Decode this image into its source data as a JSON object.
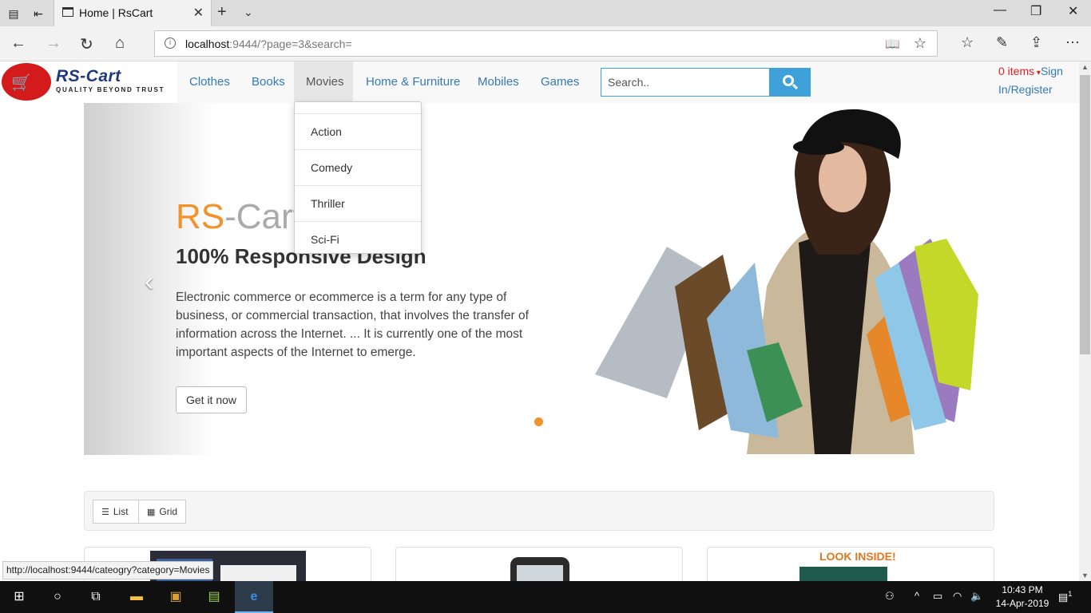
{
  "browser": {
    "tab_title": "Home | RsCart",
    "url_host": "localhost",
    "url_rest": ":9444/?page=3&search="
  },
  "site": {
    "brand": "RS-Cart",
    "tagline": "QUALITY BEYOND TRUST",
    "nav": [
      "Clothes",
      "Books",
      "Movies",
      "Home & Furniture",
      "Mobiles",
      "Games"
    ],
    "search_placeholder": "Search..",
    "cart_items": "0 items",
    "signin": "Sign In/Register"
  },
  "dropdown": {
    "items": [
      "Action",
      "Comedy",
      "Thriller",
      "Sci-Fi"
    ]
  },
  "carousel": {
    "title_part1": "RS",
    "title_part2": "-Cart",
    "subtitle": "100% Responsive Design",
    "text": "Electronic commerce or ecommerce is a term for any type of business, or commercial transaction, that involves the transfer of information across the Internet. ... It is currently one of the most important aspects of the Internet to emerge.",
    "button": "Get it now"
  },
  "view": {
    "list": "List",
    "grid": "Grid"
  },
  "status_url": "http://localhost:9444/cateogry?category=Movies",
  "taskbar": {
    "time": "10:43 PM",
    "date": "14-Apr-2019",
    "notif_count": "1"
  },
  "colors": {
    "accent": "#3ea1d9",
    "brand_orange": "#f1922a",
    "link": "#337ab7"
  }
}
